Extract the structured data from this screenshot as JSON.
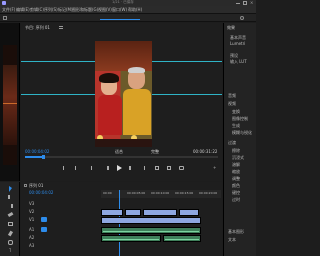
{
  "title_bar": {
    "title": "1/21 · 已保存"
  },
  "menu": {
    "items": [
      {
        "label": "文件(F)"
      },
      {
        "label": "编辑(E)"
      },
      {
        "label": "剪辑(C)"
      },
      {
        "label": "序列(S)"
      },
      {
        "label": "标记(M)"
      },
      {
        "label": "图形和标题(G)"
      },
      {
        "label": "视图(V)"
      },
      {
        "label": "窗口(W)"
      },
      {
        "label": "帮助(H)"
      }
    ]
  },
  "program_monitor": {
    "header": "节目: 序列 01",
    "menu_icon": "hamburger-icon",
    "current_time": "00:00:04:02",
    "fit_label": "适合",
    "quality_label": "完整",
    "duration": "00:00:31:22",
    "video_frame": {
      "description_colors": {
        "left_bg": "#b8342b",
        "right_bg": "#6b5a2a",
        "frame_bg": "#2a1512"
      }
    }
  },
  "right_panel": {
    "header": "效果",
    "items": [
      {
        "label": "基本声音"
      },
      {
        "label": "Lumetri"
      },
      {
        "label": "预设"
      },
      {
        "label": "输入 LUT"
      },
      {
        "label": "音频"
      },
      {
        "label": "视频"
      },
      {
        "label": "变换"
      },
      {
        "label": "图像控制"
      },
      {
        "label": "生成"
      },
      {
        "label": "模糊与锐化"
      },
      {
        "label": "过渡"
      },
      {
        "label": "擦除"
      },
      {
        "label": "沉浸式"
      },
      {
        "label": "溶解"
      },
      {
        "label": "缩放"
      },
      {
        "label": "调整"
      },
      {
        "label": "颜色"
      },
      {
        "label": "键控"
      },
      {
        "label": "过时"
      },
      {
        "label": "基本图形"
      },
      {
        "label": "文本"
      }
    ]
  },
  "timeline": {
    "header": "序列 01",
    "current_time": "00:00:04:02",
    "ruler": [
      "00:00",
      "00:00:05:00",
      "00:00:10:00",
      "00:00:15:00",
      "00:00:20:00"
    ],
    "tracks": [
      {
        "label": "V3"
      },
      {
        "label": "V2"
      },
      {
        "label": "V1"
      },
      {
        "label": "A1"
      },
      {
        "label": "A2"
      },
      {
        "label": "A3"
      }
    ],
    "playhead_colors": {
      "marker": "#2d8ceb"
    }
  },
  "colors": {
    "accent": "#2d8ceb",
    "timecode": "#2d8ceb",
    "guide": "#2fb3c6",
    "video_clip": "#8ea7e0",
    "audio_clip": "#3f7f5a"
  }
}
